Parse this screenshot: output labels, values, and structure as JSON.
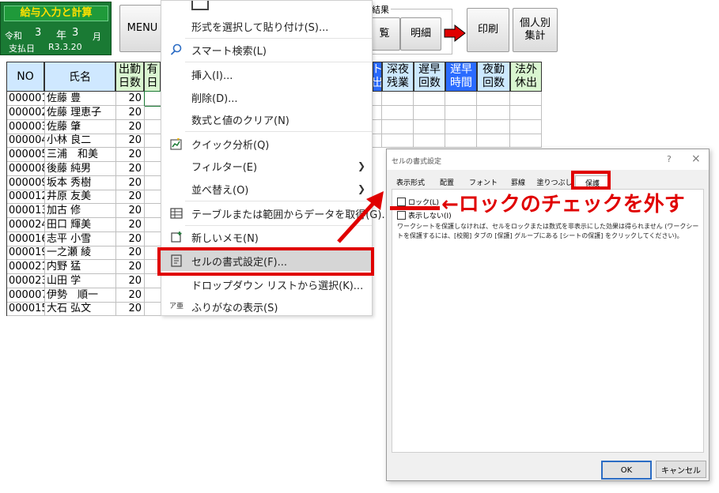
{
  "title_panel": {
    "title": "給与入力と計算",
    "era": "令和",
    "year": "3",
    "year_unit": "年",
    "month": "3",
    "month_unit": "月",
    "payday_label": "支払日",
    "payday_value": "R3.3.20"
  },
  "toolbar": {
    "menu": "MENU",
    "result_label": "結果",
    "btn_ichiran": "覧",
    "btn_meisai": "明細",
    "btn_print": "印刷",
    "btn_kojin_1": "個人別",
    "btn_kojin_2": "集計"
  },
  "headers": {
    "no": "NO",
    "name": "氏名",
    "shukkin_1": "出勤",
    "shukkin_2": "日数",
    "yu_1": "有",
    "yu_2": "日",
    "partial_1": "ト",
    "partial_2": "出",
    "shinya_1": "深夜",
    "shinya_2": "残業",
    "chisou_1": "遅早",
    "chisou_2": "回数",
    "chisouj_1": "遅早",
    "chisouj_2": "時間",
    "yakin_1": "夜勤",
    "yakin_2": "回数",
    "hougai_1": "法外",
    "hougai_2": "休出"
  },
  "rows": [
    {
      "no": "000001",
      "name": "佐藤 豊",
      "days": "20"
    },
    {
      "no": "000002",
      "name": "佐藤 理恵子",
      "days": "20"
    },
    {
      "no": "000003",
      "name": "佐藤 肇",
      "days": "20"
    },
    {
      "no": "000004",
      "name": "小林 良二",
      "days": "20"
    },
    {
      "no": "000005",
      "name": "三浦　和美",
      "days": "20"
    },
    {
      "no": "000008",
      "name": "後藤 純男",
      "days": "20"
    },
    {
      "no": "000009",
      "name": "坂本 秀樹",
      "days": "20"
    },
    {
      "no": "000012",
      "name": "井原 友美",
      "days": "20"
    },
    {
      "no": "000013",
      "name": "加古 修",
      "days": "20"
    },
    {
      "no": "000024",
      "name": "田口 輝美",
      "days": "20"
    },
    {
      "no": "000016",
      "name": "志平 小雪",
      "days": "20"
    },
    {
      "no": "000019",
      "name": "一之瀬 綾",
      "days": "20"
    },
    {
      "no": "000021",
      "name": "内野 猛",
      "days": "20"
    },
    {
      "no": "000023",
      "name": "山田 学",
      "days": "20"
    },
    {
      "no": "000007",
      "name": "伊勢　順一",
      "days": "20"
    },
    {
      "no": "000015",
      "name": "大石 弘文",
      "days": "20"
    }
  ],
  "context_menu": {
    "paste_special": "形式を選択して貼り付け(S)...",
    "smart_lookup": "スマート検索(L)",
    "insert": "挿入(I)...",
    "delete": "削除(D)...",
    "clear": "数式と値のクリア(N)",
    "quick_analysis": "クイック分析(Q)",
    "filter": "フィルター(E)",
    "sort": "並べ替え(O)",
    "get_data": "テーブルまたは範囲からデータを取得(G)...",
    "new_note": "新しいメモ(N)",
    "format_cells": "セルの書式設定(F)...",
    "dropdown": "ドロップダウン リストから選択(K)...",
    "furigana": "ふりがなの表示(S)",
    "furigana_icon": "ア亜"
  },
  "dialog": {
    "title": "セルの書式設定",
    "help": "?",
    "close": "×",
    "tabs": [
      "表示形式",
      "配置",
      "フォント",
      "罫線",
      "塗りつぶし",
      "保護"
    ],
    "lock_label": "ロック(L)",
    "hide_label": "表示しない(I)",
    "description": "ワークシートを保護しなければ、セルをロックまたは数式を非表示にした効果は得られません (ワークシートを保護するには、[校閲] タブの [保護] グループにある [シートの保護] をクリックしてください)。",
    "ok": "OK",
    "cancel": "キャンセル"
  },
  "annotation": {
    "text": "←ロックのチェックを外す",
    "color": "#e00000"
  }
}
